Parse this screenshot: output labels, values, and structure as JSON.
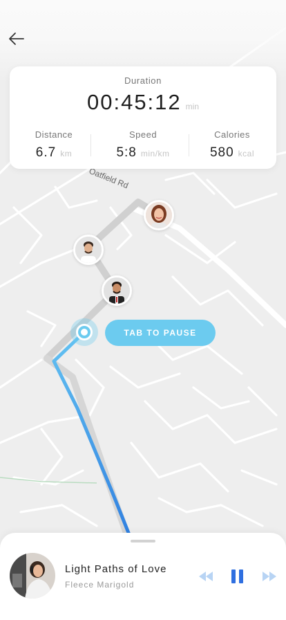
{
  "map": {
    "street_label": "Oatfield Rd"
  },
  "stats": {
    "duration_label": "Duration",
    "duration_value": "00:45:12",
    "duration_unit": "min",
    "metrics": [
      {
        "label": "Distance",
        "value": "6.7",
        "unit": "km"
      },
      {
        "label": "Speed",
        "value": "5:8",
        "unit": "min/km"
      },
      {
        "label": "Calories",
        "value": "580",
        "unit": "kcal"
      }
    ]
  },
  "pause_button_label": "TAB TO PAUSE",
  "player": {
    "title": "Light Paths of Love",
    "artist": "Fleece Marigold"
  },
  "colors": {
    "accent": "#6ccbef",
    "route_blue": "#3f8ee6",
    "route_gray": "#d0d0d0",
    "pause_icon": "#2f6fe0"
  }
}
